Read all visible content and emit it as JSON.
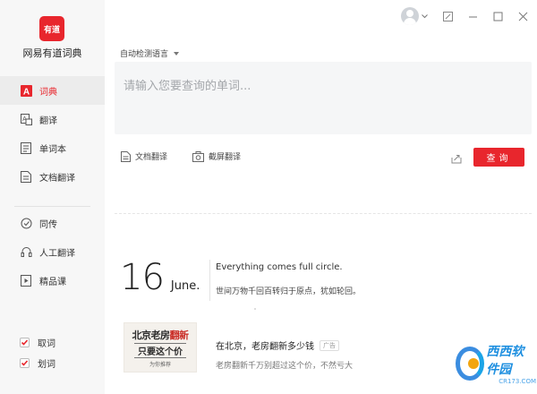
{
  "app": {
    "logo_text": "有道",
    "name": "网易有道词典"
  },
  "sidebar": {
    "items": [
      {
        "label": "词典",
        "icon": "dictionary-icon",
        "active": true
      },
      {
        "label": "翻译",
        "icon": "translate-icon",
        "active": false
      },
      {
        "label": "单词本",
        "icon": "wordbook-icon",
        "active": false
      },
      {
        "label": "文档翻译",
        "icon": "document-translate-icon",
        "active": false
      }
    ],
    "items2": [
      {
        "label": "同传",
        "icon": "simultaneous-icon"
      },
      {
        "label": "人工翻译",
        "icon": "human-translate-icon"
      },
      {
        "label": "精品课",
        "icon": "course-icon"
      }
    ],
    "checks": [
      {
        "label": "取词",
        "checked": true
      },
      {
        "label": "划词",
        "checked": true
      }
    ]
  },
  "header": {
    "language_selector": "自动检测语言"
  },
  "search": {
    "placeholder": "请输入您要查询的单词...",
    "value": "",
    "button_label": "查询"
  },
  "tools": {
    "doc_translate": "文档翻译",
    "screenshot_translate": "截屏翻译"
  },
  "daily": {
    "day": "16",
    "month": "June.",
    "quote_en": "Everything comes full circle.",
    "quote_zh": "世间万物千回百转归于原点，犹如轮回。"
  },
  "news": {
    "image_line1_a": "北京老房",
    "image_line1_b": "翻新",
    "image_line2": "只要这个价",
    "image_line3": "为你推荐",
    "title": "在北京，老房翻新多少钱",
    "ad_label": "广告",
    "desc": "老房翻新千万别超过这个价，不然亏大"
  },
  "watermark": {
    "text": "西西软件园",
    "sub": "CR173.COM"
  },
  "colors": {
    "accent": "#e8262d",
    "sidebar_bg": "#f7f7f7",
    "input_bg": "#f5f6f7"
  }
}
